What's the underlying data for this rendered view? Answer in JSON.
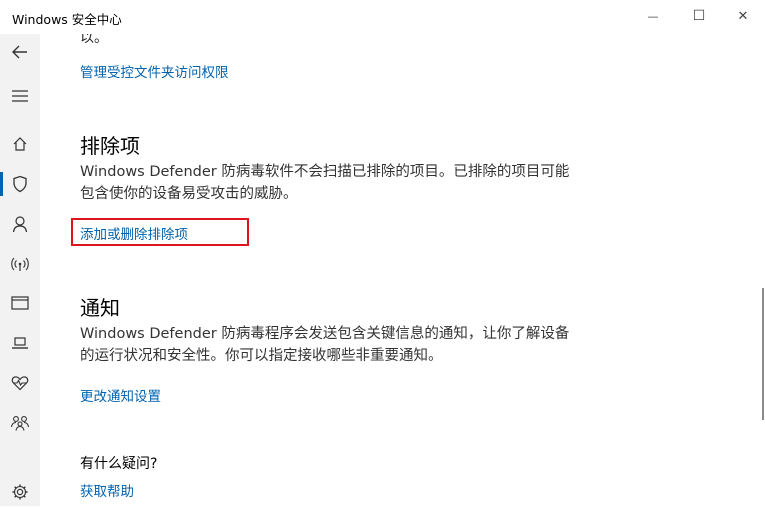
{
  "window": {
    "title": "Windows 安全中心",
    "minimize_glyph": "—",
    "maximize_glyph": "☐",
    "close_glyph": "✕"
  },
  "sidebar": {
    "items": [
      {
        "icon": "back-arrow-icon"
      },
      {
        "icon": "hamburger-menu-icon"
      },
      {
        "icon": "home-icon"
      },
      {
        "icon": "shield-icon",
        "active": true
      },
      {
        "icon": "person-icon"
      },
      {
        "icon": "wireless-icon"
      },
      {
        "icon": "browser-window-icon"
      },
      {
        "icon": "laptop-icon"
      },
      {
        "icon": "heart-pulse-icon"
      },
      {
        "icon": "family-icon"
      },
      {
        "icon": "gear-icon"
      }
    ],
    "accent_color": "#0063b1"
  },
  "main": {
    "cut_text": "以。",
    "manage_folder_link": "管理受控文件夹访问权限",
    "exclusions": {
      "title": "排除项",
      "description": "Windows Defender 防病毒软件不会扫描已排除的项目。已排除的项目可能包含使你的设备易受攻击的威胁。",
      "link": "添加或删除排除项"
    },
    "notifications": {
      "title": "通知",
      "description": "Windows Defender 防病毒程序会发送包含关键信息的通知，让你了解设备的运行状况和安全性。你可以指定接收哪些非重要通知。",
      "link": "更改通知设置"
    },
    "help": {
      "title": "有什么疑问?",
      "link": "获取帮助"
    }
  },
  "colors": {
    "link": "#0063b1",
    "highlight_border": "#e0141e",
    "sidebar_bg": "#f2f2f2"
  }
}
